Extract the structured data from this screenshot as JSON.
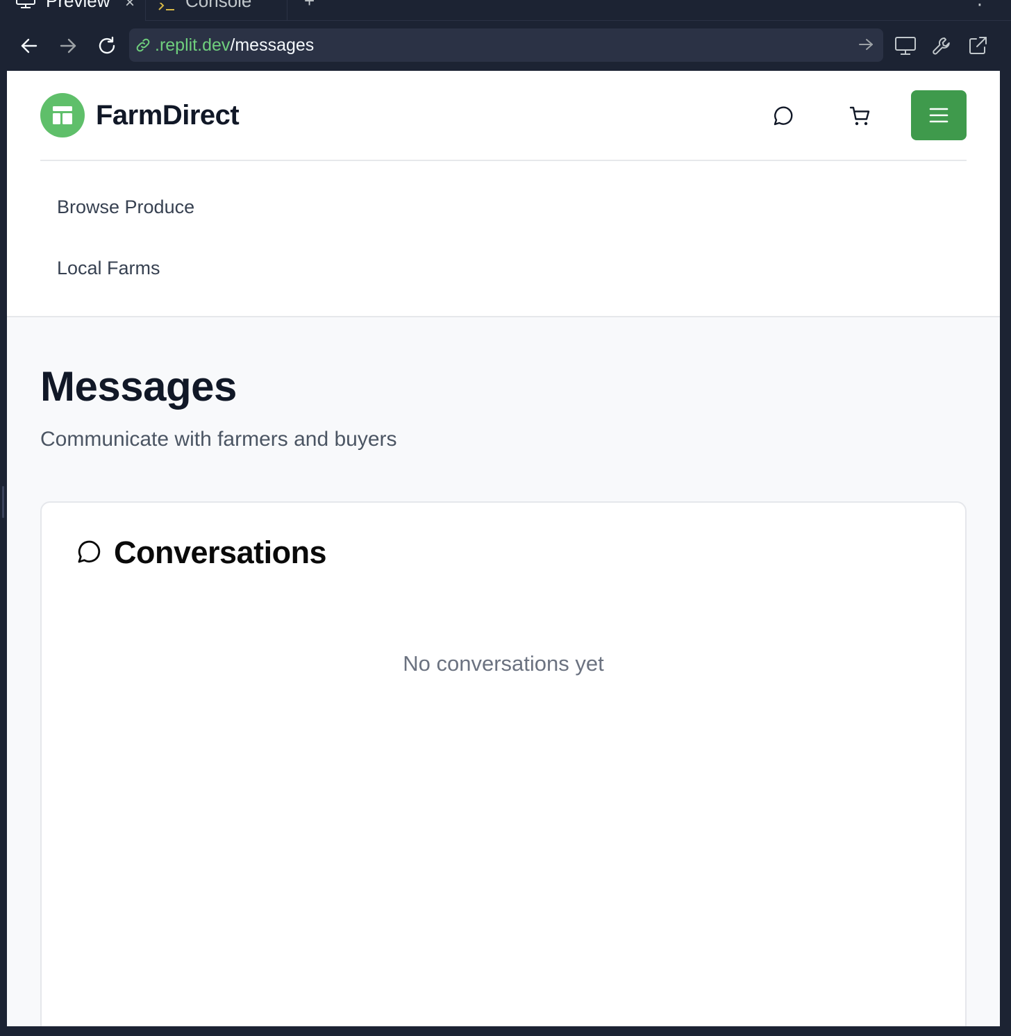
{
  "ide": {
    "tabs": [
      {
        "label": "Preview",
        "icon": "monitor-icon",
        "active": true
      },
      {
        "label": "Console",
        "icon": "terminal-icon",
        "active": false
      }
    ],
    "tab_close": "×",
    "tab_add": "+",
    "tab_more": "⋮",
    "url": {
      "host": ".replit.dev",
      "path": "/messages"
    }
  },
  "app": {
    "brand": {
      "name": "FarmDirect",
      "logo_icon": "storefront-icon",
      "logo_color": "#5fbf6a"
    },
    "header_icons": [
      "message-circle-icon",
      "shopping-cart-icon"
    ],
    "menu_button_color": "#3f9a4c",
    "nav": [
      {
        "label": "Browse Produce"
      },
      {
        "label": "Local Farms"
      }
    ],
    "page": {
      "title": "Messages",
      "subtitle": "Communicate with farmers and buyers"
    },
    "conversations": {
      "title": "Conversations",
      "empty_text": "No conversations yet"
    }
  }
}
